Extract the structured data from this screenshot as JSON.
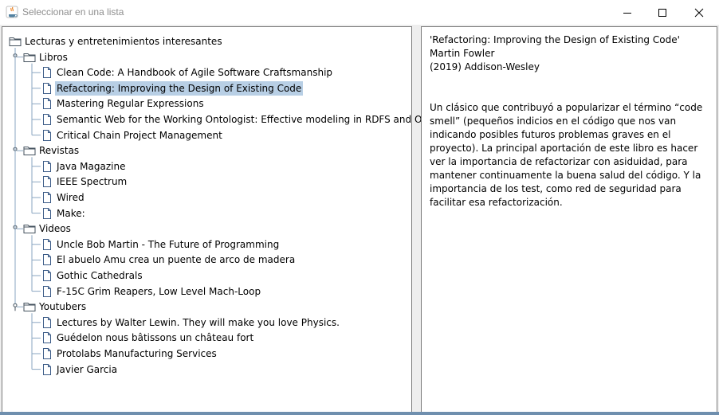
{
  "window": {
    "title": "Seleccionar en una lista",
    "controls": {
      "minimize": "—",
      "maximize": "☐",
      "close": "✕"
    }
  },
  "tree": {
    "root": "Lecturas y entretenimientos interesantes",
    "groups": [
      {
        "label": "Libros",
        "items": [
          "Clean Code: A Handbook of Agile Software Craftsmanship",
          "Refactoring: Improving the Design of Existing Code",
          "Mastering Regular Expressions",
          "Semantic Web for the Working Ontologist: Effective modeling in RDFS and OWL",
          "Critical Chain Project Management"
        ]
      },
      {
        "label": "Revistas",
        "items": [
          "Java Magazine",
          "IEEE Spectrum",
          "Wired",
          "Make:"
        ]
      },
      {
        "label": "Videos",
        "items": [
          "Uncle Bob Martin - The Future of Programming",
          "El abuelo Amu crea un puente de arco de madera",
          "Gothic Cathedrals",
          "F-15C Grim Reapers, Low Level Mach-Loop"
        ]
      },
      {
        "label": "Youtubers",
        "items": [
          "Lectures by Walter Lewin. They will make you love Physics.",
          "Guédelon nous bâtissons un château fort",
          "Protolabs Manufacturing Services",
          "Javier Garcia"
        ]
      }
    ],
    "selected": "Refactoring: Improving the Design of Existing Code"
  },
  "detail": {
    "title": "'Refactoring: Improving the Design of Existing Code'",
    "author": "Martin Fowler",
    "publication": "(2019) Addison-Wesley",
    "description": " Un clásico que contribuyó a popularizar el término “code smell” (pequeños indicios en el código que nos van indicando posibles futuros problemas graves en el proyecto). La principal aportación de este libro es hacer ver la importancia de refactorizar con asiduidad, para mantener continuamente la buena salud del código. Y la importancia de los test, como red de seguridad para facilitar esa refactorización."
  },
  "colors": {
    "selection": "#b8cfe5",
    "pane_border": "#7a7a7a",
    "client_bg": "#eeeeee",
    "title_text": "#8e8e8e",
    "tree_lines": "#8aa6c1"
  }
}
